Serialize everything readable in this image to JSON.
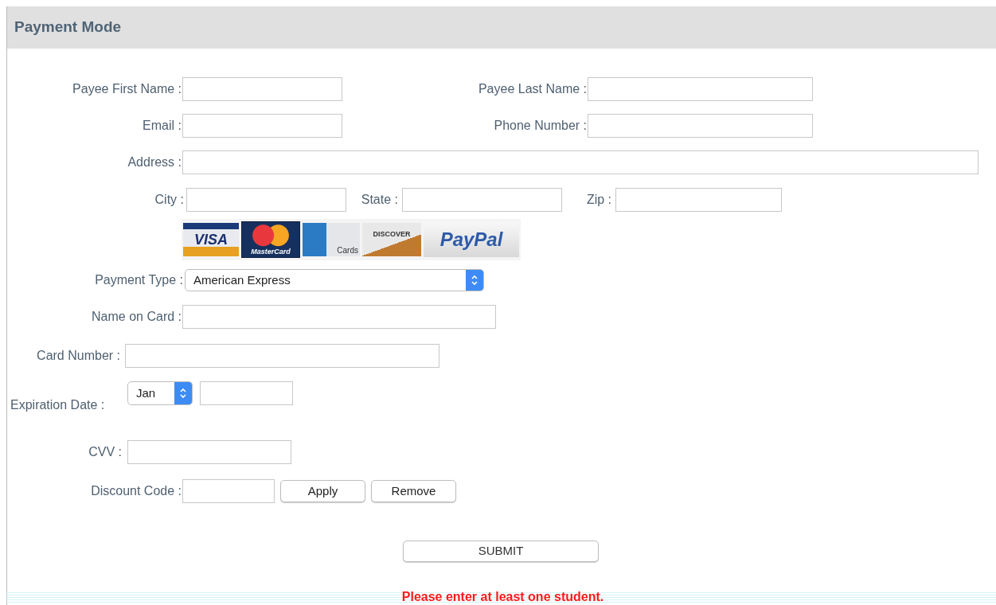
{
  "section": {
    "title": "Payment Mode"
  },
  "fields": [
    {
      "label": "Payee First Name :"
    },
    {
      "label": "Payee Last Name :"
    },
    {
      "label": "Email :"
    },
    {
      "label": "Phone Number :"
    },
    {
      "label": "Address :"
    },
    {
      "label": "City :"
    },
    {
      "label": "State :"
    },
    {
      "label": "Zip :"
    }
  ],
  "card_logos": [
    {
      "kind": "visa",
      "label": "VISA"
    },
    {
      "kind": "mastercard",
      "label": "MasterCard"
    },
    {
      "kind": "amex",
      "label": "Cards"
    },
    {
      "kind": "discover",
      "label": "DISCOVER"
    },
    {
      "kind": "paypal",
      "label": "PayPal"
    }
  ],
  "payment_type": {
    "label": "Payment Type :",
    "value": "American Express"
  },
  "name_on_card": {
    "label": "Name on Card :"
  },
  "card_number": {
    "label": "Card Number :"
  },
  "expiration": {
    "label": "Expiration Date :",
    "month": "Jan"
  },
  "cvv": {
    "label": "CVV :"
  },
  "discount": {
    "label": "Discount Code :",
    "buttons": [
      "Apply",
      "Remove"
    ]
  },
  "submit": "SUBMIT",
  "error": "Please enter at least one student."
}
